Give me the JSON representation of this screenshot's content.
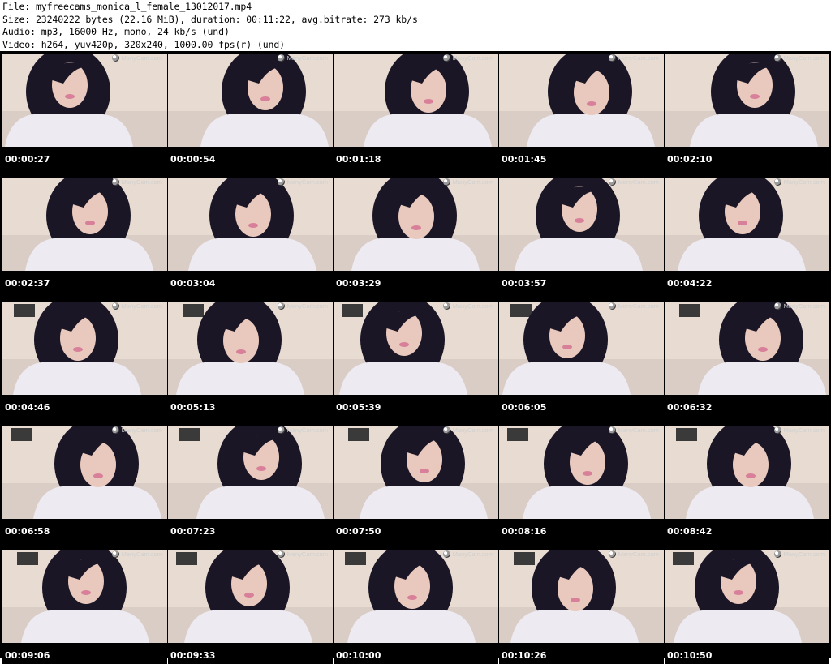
{
  "header": {
    "file_line": "File: myfreecams_monica_l_female_13012017.mp4",
    "size_line": "Size: 23240222 bytes (22.16 MiB), duration: 00:11:22, avg.bitrate: 273 kb/s",
    "audio_line": "Audio: mp3, 16000 Hz, mono, 24 kb/s (und)",
    "video_line": "Video: h264, yuv420p, 320x240, 1000.00 fps(r) (und)"
  },
  "watermark": "ManyCam.com",
  "watermark_icon": "webcam-logo-icon",
  "colors": {
    "background": "#000000",
    "timestamp": "#ffffff",
    "hair": "#1a1626",
    "blouse": "#eeeaf2",
    "wall": "#e8dcd2",
    "skin": "#e9c9bd"
  },
  "thumbnails": [
    {
      "timestamp": "00:00:27"
    },
    {
      "timestamp": "00:00:54"
    },
    {
      "timestamp": "00:01:18"
    },
    {
      "timestamp": "00:01:45"
    },
    {
      "timestamp": "00:02:10"
    },
    {
      "timestamp": "00:02:37"
    },
    {
      "timestamp": "00:03:04"
    },
    {
      "timestamp": "00:03:29"
    },
    {
      "timestamp": "00:03:57"
    },
    {
      "timestamp": "00:04:22"
    },
    {
      "timestamp": "00:04:46"
    },
    {
      "timestamp": "00:05:13"
    },
    {
      "timestamp": "00:05:39"
    },
    {
      "timestamp": "00:06:05"
    },
    {
      "timestamp": "00:06:32"
    },
    {
      "timestamp": "00:06:58"
    },
    {
      "timestamp": "00:07:23"
    },
    {
      "timestamp": "00:07:50"
    },
    {
      "timestamp": "00:08:16"
    },
    {
      "timestamp": "00:08:42"
    },
    {
      "timestamp": "00:09:06"
    },
    {
      "timestamp": "00:09:33"
    },
    {
      "timestamp": "00:10:00"
    },
    {
      "timestamp": "00:10:26"
    },
    {
      "timestamp": "00:10:50"
    }
  ]
}
